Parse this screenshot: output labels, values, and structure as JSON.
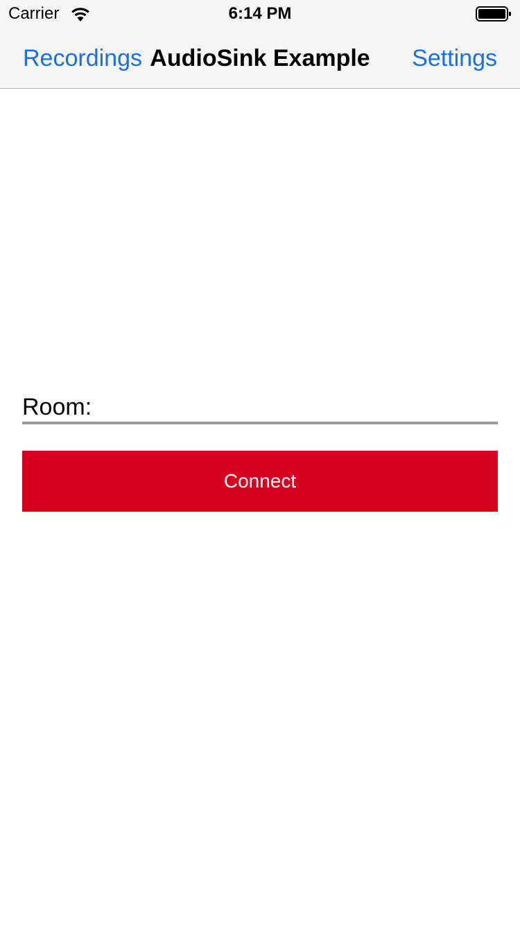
{
  "status_bar": {
    "carrier": "Carrier",
    "time": "6:14 PM",
    "wifi_icon": "wifi-icon",
    "battery_icon": "battery-full-icon"
  },
  "nav_bar": {
    "left_button": "Recordings",
    "title": "AudioSink Example",
    "right_button": "Settings"
  },
  "room": {
    "label": "Room:",
    "value": "",
    "placeholder": ""
  },
  "connect_button": {
    "label": "Connect"
  },
  "colors": {
    "accent_blue": "#1a6fe8",
    "button_red": "#d8001f",
    "nav_background": "#f6f6f6",
    "underline_gray": "#9b9b9b"
  }
}
